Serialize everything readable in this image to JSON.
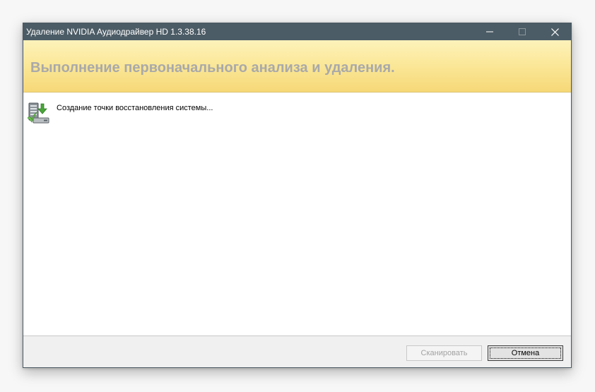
{
  "window": {
    "title": "Удаление NVIDIA Аудиодрайвер HD 1.3.38.16",
    "controls": {
      "minimize_icon": "minimize-icon",
      "maximize_icon": "maximize-icon",
      "close_icon": "close-icon"
    }
  },
  "banner": {
    "title": "Выполнение первоначального анализа и удаления."
  },
  "status": {
    "icon": "restore-point-icon",
    "text": "Создание точки восстановления системы..."
  },
  "footer": {
    "scan_label": "Сканировать",
    "scan_enabled": false,
    "cancel_label": "Отмена"
  },
  "colors": {
    "titlebar": "#4c5c66",
    "banner_top": "#fdf2bb",
    "banner_bottom": "#f6d877",
    "banner_text": "#a9a9a9"
  }
}
